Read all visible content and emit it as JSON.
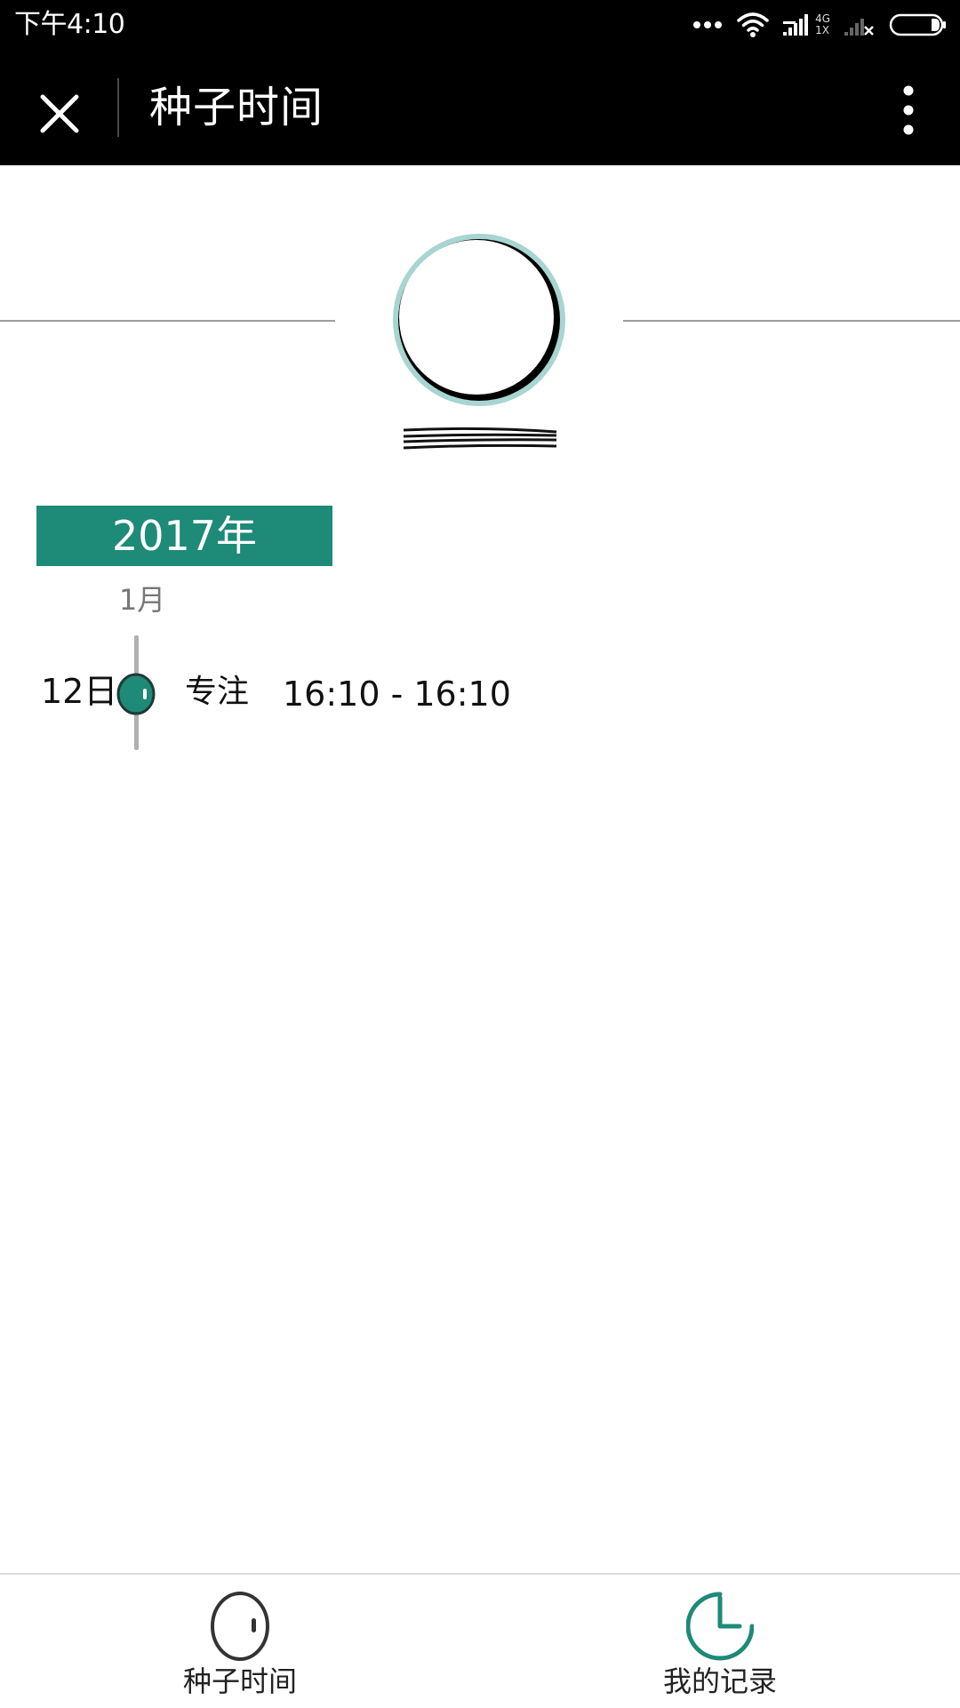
{
  "status_bar": {
    "time": "下午4:10",
    "network_type_top": "4G",
    "network_type_bottom": "1X"
  },
  "title_bar": {
    "title": "种子时间"
  },
  "profile": {
    "username": "— — — —"
  },
  "timeline": {
    "year": "2017年",
    "month": "1月",
    "entries": [
      {
        "day": "12日",
        "type": "专注",
        "time_range": "16:10 - 16:10"
      }
    ]
  },
  "bottom_nav": {
    "items": [
      {
        "label": "种子时间",
        "icon": "seed-icon"
      },
      {
        "label": "我的记录",
        "icon": "clock-icon"
      }
    ]
  },
  "colors": {
    "accent": "#1e8a78",
    "avatar_ring": "#a8d5cf",
    "bar_background": "#000000"
  }
}
